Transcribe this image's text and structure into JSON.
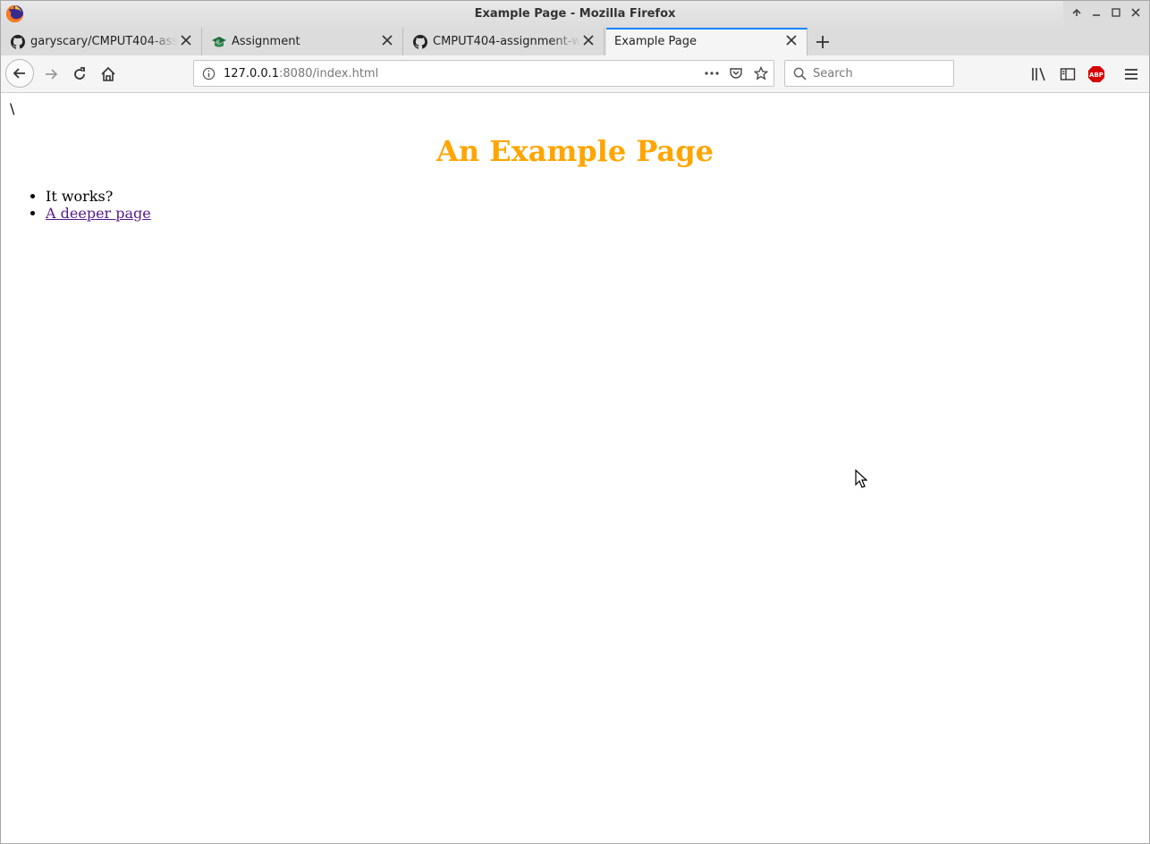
{
  "window": {
    "title": "Example Page - Mozilla Firefox"
  },
  "tabs": [
    {
      "label": "garyscary/CMPUT404-assi",
      "icon": "github-icon"
    },
    {
      "label": "Assignment",
      "icon": "eclass-cap-icon"
    },
    {
      "label": "CMPUT404-assignment-w",
      "icon": "github-icon"
    },
    {
      "label": "Example Page",
      "active": true
    }
  ],
  "navbar": {
    "url_host": "127.0.0.1",
    "url_rest": ":8080/index.html",
    "search_placeholder": "Search",
    "abp_label": "ABP"
  },
  "page": {
    "stray_text": "\\",
    "heading": "An Example Page",
    "heading_color": "#ffa500",
    "list": [
      {
        "text": "It works?"
      },
      {
        "text": "A deeper page",
        "link": true,
        "link_color": "#551a8b"
      }
    ]
  }
}
